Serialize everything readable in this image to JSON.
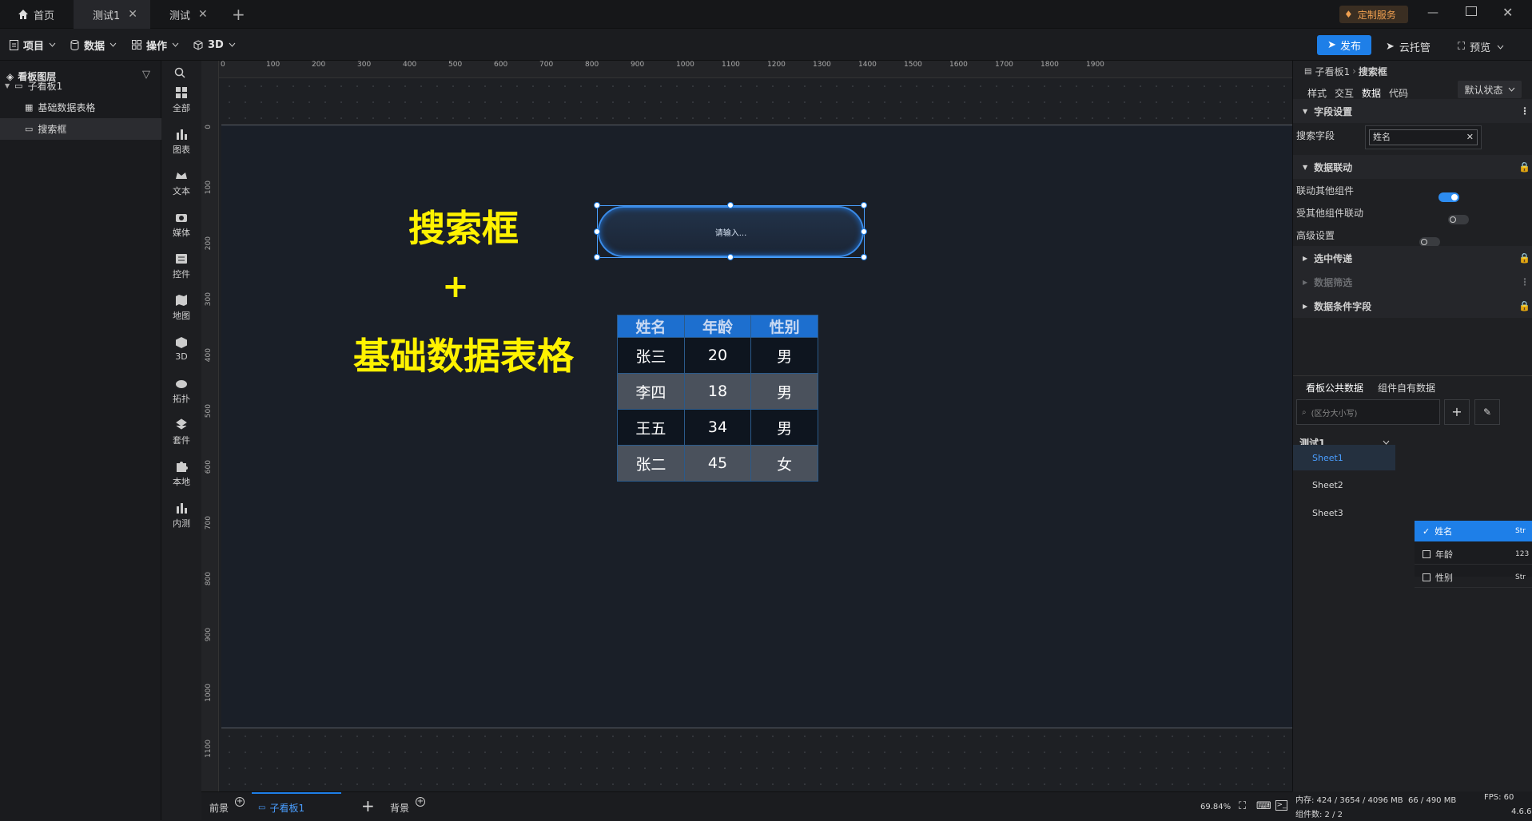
{
  "tabs": [
    {
      "label": "首页",
      "icon": "home-icon"
    },
    {
      "label": "测试1",
      "close": "✕"
    },
    {
      "label": "测试",
      "close": "✕"
    }
  ],
  "titlebar": {
    "service_label": "定制服务",
    "add_tab": "+"
  },
  "menus": [
    {
      "label": "项目",
      "icon": "file-icon"
    },
    {
      "label": "数据",
      "icon": "database-icon"
    },
    {
      "label": "操作",
      "icon": "grid-icon"
    },
    {
      "label": "3D",
      "icon": "cube-icon"
    }
  ],
  "actions": {
    "publish": "发布",
    "cloud": "云托管",
    "preview": "预览"
  },
  "layers": {
    "title": "看板图层",
    "items": [
      {
        "label": "子看板1"
      },
      {
        "label": "基础数据表格"
      },
      {
        "label": "搜索框"
      }
    ]
  },
  "strip": [
    "全部",
    "图表",
    "文本",
    "媒体",
    "控件",
    "地图",
    "3D",
    "拓扑",
    "套件",
    "本地",
    "内测"
  ],
  "ruler_top": [
    "0",
    "100",
    "200",
    "300",
    "400",
    "500",
    "600",
    "700",
    "800",
    "900",
    "1000",
    "1100",
    "1200",
    "1300",
    "1400",
    "1500",
    "1600",
    "1700",
    "1800",
    "1900"
  ],
  "ruler_left": [
    "0",
    "100",
    "200",
    "300",
    "400",
    "500",
    "600",
    "700",
    "800",
    "900",
    "1000",
    "1100"
  ],
  "canvas": {
    "title1": "搜索框",
    "plus": "+",
    "title2": "基础数据表格",
    "search_placeholder": "请输入...",
    "table": {
      "headers": [
        "姓名",
        "年龄",
        "性别"
      ],
      "rows": [
        [
          "张三",
          "20",
          "男"
        ],
        [
          "李四",
          "18",
          "男"
        ],
        [
          "王五",
          "34",
          "男"
        ],
        [
          "张二",
          "45",
          "女"
        ]
      ]
    }
  },
  "right": {
    "breadcrumb": [
      "子看板1",
      "搜索框"
    ],
    "tabs": [
      "样式",
      "交互",
      "数据",
      "代码"
    ],
    "state": "默认状态",
    "field_section": "字段设置",
    "search_field_label": "搜索字段",
    "search_field_value": "姓名",
    "linkage_section": "数据联动",
    "link_other": "联动其他组件",
    "linked_by": "受其他组件联动",
    "advanced": "高级设置",
    "selected_pass": "选中传递",
    "data_filter": "数据筛选",
    "data_condition": "数据条件字段",
    "data_tabs": [
      "看板公共数据",
      "组件自有数据"
    ],
    "search_placeholder": "(区分大小写)",
    "dataset": "测试1",
    "sheets": [
      "Sheet1",
      "Sheet2",
      "Sheet3"
    ],
    "fields": [
      {
        "name": "姓名",
        "type": "Str",
        "checked": true
      },
      {
        "name": "年龄",
        "type": "123",
        "checked": false
      },
      {
        "name": "性别",
        "type": "Str",
        "checked": false
      }
    ]
  },
  "bottom": {
    "front": "前景",
    "board": "子看板1",
    "add": "+",
    "back": "背景",
    "zoom": "69.84%"
  },
  "status": {
    "memory": "内存: 424 / 3654 / 4096 MB  66 / 490 MB",
    "fps": "FPS: 60",
    "count": "组件数: 2 / 2",
    "version": "4.6.6"
  },
  "colors": {
    "accent": "#1e7fe8",
    "title_yellow": "#fff200"
  }
}
